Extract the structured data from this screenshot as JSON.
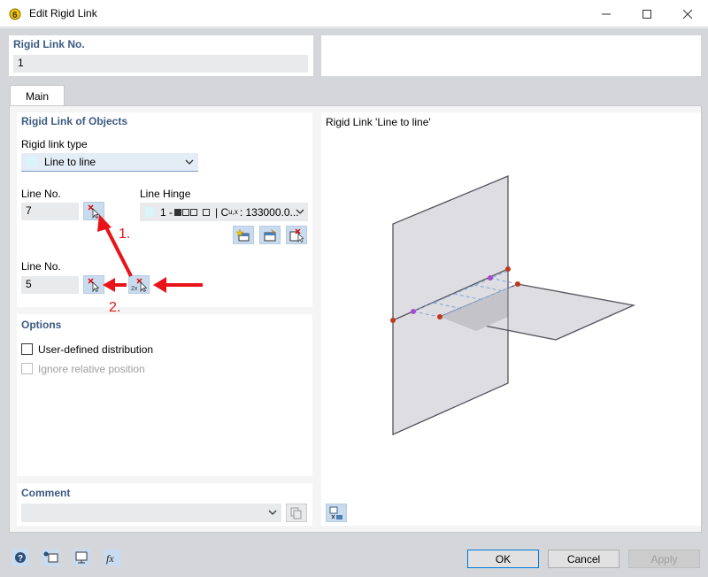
{
  "window": {
    "title": "Edit Rigid Link"
  },
  "header": {
    "number_label": "Rigid Link No.",
    "number_value": "1"
  },
  "tabs": [
    {
      "label": "Main"
    }
  ],
  "rigid_link": {
    "section_title": "Rigid Link of Objects",
    "type_label": "Rigid link type",
    "type_value": "Line to line",
    "line_no_1_label": "Line No.",
    "line_no_1_value": "7",
    "line_hinge_label": "Line Hinge",
    "line_hinge_prefix": "1 - ",
    "line_hinge_suffix": "| C",
    "line_hinge_sub": "u,x",
    "line_hinge_value": ": 133000.0...",
    "line_no_2_label": "Line No.",
    "line_no_2_value": "5"
  },
  "annotations": {
    "step1": "1.",
    "step2": "2.",
    "badge_2x": "2x"
  },
  "options": {
    "section_title": "Options",
    "user_defined": "User-defined distribution",
    "ignore_relative": "Ignore relative position"
  },
  "comment": {
    "section_title": "Comment",
    "value": ""
  },
  "preview": {
    "title": "Rigid Link 'Line to line'"
  },
  "footer": {
    "ok": "OK",
    "cancel": "Cancel",
    "apply": "Apply"
  },
  "colors": {
    "section_label": "#3c5a82",
    "arrow": "#e8141a",
    "icon_bg": "#c9dcef"
  }
}
